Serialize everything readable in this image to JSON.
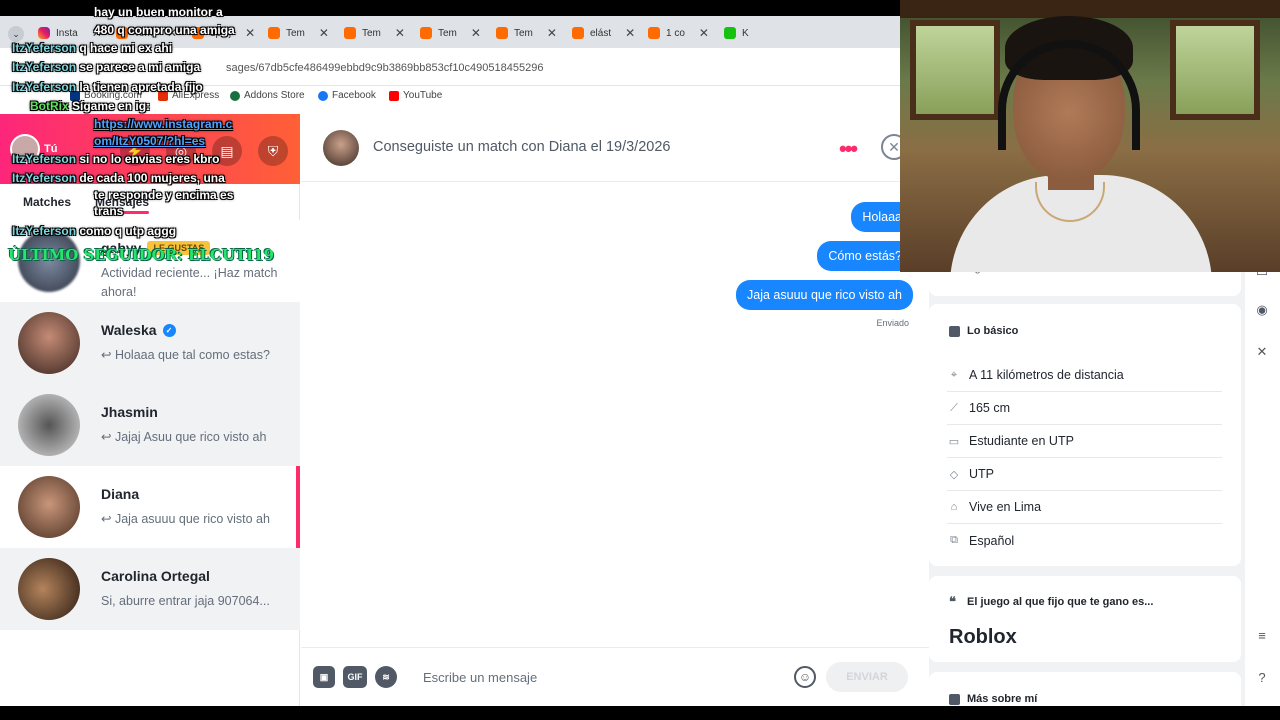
{
  "browser": {
    "tabs": [
      {
        "label": "Insta",
        "type": "ig"
      },
      {
        "label": "Tem",
        "type": "orange"
      },
      {
        "label": "1pc j",
        "type": "orange"
      },
      {
        "label": "Tem",
        "type": "orange"
      },
      {
        "label": "Tem",
        "type": "orange"
      },
      {
        "label": "Tem",
        "type": "orange"
      },
      {
        "label": "Tem",
        "type": "orange"
      },
      {
        "label": "elást",
        "type": "orange"
      },
      {
        "label": "1 co",
        "type": "orange"
      },
      {
        "label": "K",
        "type": "k"
      }
    ],
    "url": "sages/67db5cfe486499ebbd9c9b3869bb853cf10c490518455296",
    "bookmarks": [
      "Booking.com",
      "AliExpress",
      "Addons Store",
      "Facebook",
      "YouTube"
    ]
  },
  "sidebar": {
    "me_label": "Tú",
    "tabs": {
      "matches": "Matches",
      "messages": "Mensajes"
    },
    "conversations": [
      {
        "name": "gabyy",
        "badge": "LE GUSTAS",
        "preview": "Actividad reciente... ¡Haz match ahora!",
        "verified": false
      },
      {
        "name": "Waleska",
        "preview": "Holaaa que tal como estas?",
        "verified": true
      },
      {
        "name": "Jhasmin",
        "preview": "Jajaj Asuu que rico visto ah",
        "verified": false
      },
      {
        "name": "Diana",
        "preview": "Jaja asuuu que rico visto ah",
        "verified": false
      },
      {
        "name": "Carolina Ortegal",
        "preview": "Si, aburre entrar jaja 907064...",
        "verified": false
      }
    ]
  },
  "chat": {
    "title": "Conseguiste un match con Diana el 19/3/2026",
    "messages": [
      "Holaaa",
      "Cómo estás?",
      "Jaja asuuu que rico visto ah"
    ],
    "sent_label": "Enviado",
    "composer": {
      "gif_label": "GIF",
      "placeholder": "Escribe un mensaje",
      "send_label": "ENVIAR"
    }
  },
  "profile": {
    "partial_text": "Contiger",
    "basics_title": "Lo básico",
    "basics": [
      {
        "icon": "location-icon",
        "text": "A 11 kilómetros de distancia"
      },
      {
        "icon": "ruler-icon",
        "text": "165 cm"
      },
      {
        "icon": "briefcase-icon",
        "text": "Estudiante en UTP"
      },
      {
        "icon": "graduation-icon",
        "text": "UTP"
      },
      {
        "icon": "home-icon",
        "text": "Vive en Lima"
      },
      {
        "icon": "language-icon",
        "text": "Español"
      }
    ],
    "prompt_title": "El juego al que fijo que te gano es...",
    "prompt_answer": "Roblox",
    "more_title": "Más sobre mí"
  },
  "stream_chat": [
    {
      "user": "",
      "text": "hay un buen monitor a"
    },
    {
      "user": "",
      "text": "480 q compro una amiga"
    },
    {
      "user": "ItzYeferson",
      "text": "q hace mi ex ahi"
    },
    {
      "user": "ItzYeferson",
      "text": "se parece a mi amiga"
    },
    {
      "user": "ItzYeferson",
      "text": "la tienen apretada fijo"
    },
    {
      "user": "BotRix",
      "text": "Sígame en ig:"
    },
    {
      "user": "",
      "text": "https://www.instagram.c",
      "link": true
    },
    {
      "user": "",
      "text": "om/ItzY0507/?hl=es",
      "link": true
    },
    {
      "user": "ItzYeferson",
      "text": "si no lo envias eres kbro"
    },
    {
      "user": "ItzYeferson",
      "text": "de cada 100 mujeres, una"
    },
    {
      "user": "",
      "text": "te responde y encima es"
    },
    {
      "user": "",
      "text": "trans"
    },
    {
      "user": "ItzYeferson",
      "text": "como q utp aggg"
    }
  ],
  "stream_follower": "ÚLTIMO SEGUIDOR: ELCUTI19",
  "colors": {
    "brand": "#fd2d6c",
    "bubble": "#1786ff",
    "follower": "#27e46a"
  }
}
